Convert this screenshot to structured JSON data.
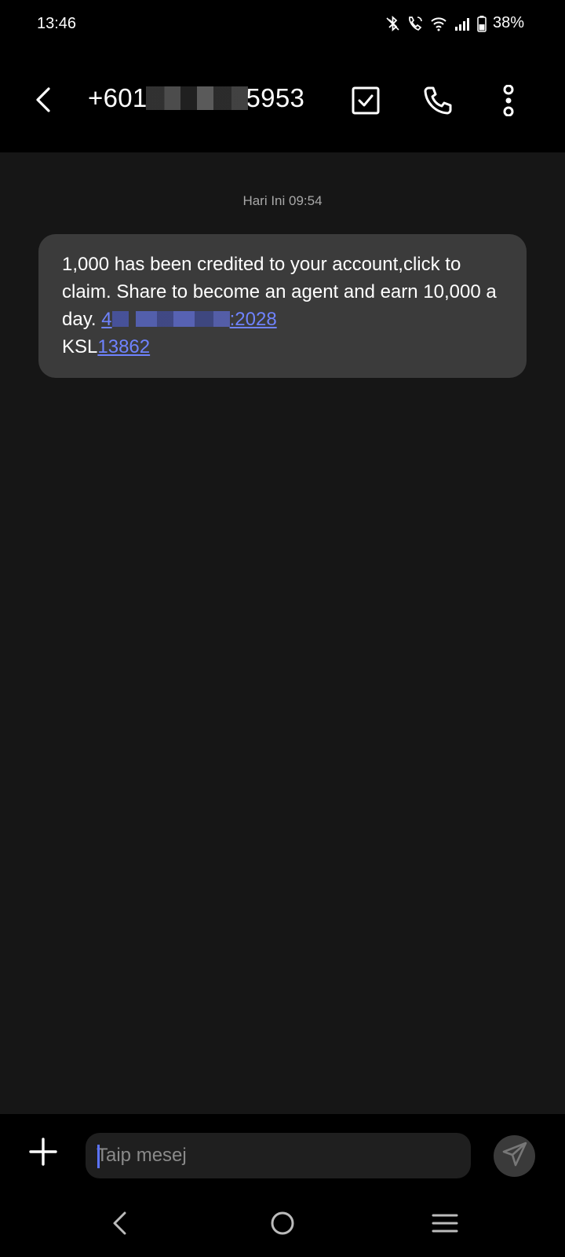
{
  "status_bar": {
    "time": "13:46",
    "battery": "38%",
    "icons": [
      "bluetooth-icon",
      "wifi-calling-icon",
      "wifi-icon",
      "signal-icon",
      "battery-icon"
    ]
  },
  "header": {
    "number_prefix": "+601",
    "number_suffix": "5953",
    "icons": [
      "back-arrow-icon",
      "select-checkbox-icon",
      "phone-call-icon",
      "more-options-icon"
    ]
  },
  "conversation": {
    "date_label": "Hari Ini 09:54",
    "message": {
      "text_main": "1,000 has been credited to your account,click to claim. Share to become an agent and earn 10,000 a day. ",
      "link1_start": "4",
      "link1_end": ":2028",
      "line2_prefix": "KSL",
      "link2": "13862"
    }
  },
  "composer": {
    "placeholder": "Taip mesej",
    "icons": [
      "add-attachment-icon",
      "send-icon"
    ]
  },
  "nav_bar": {
    "icons": [
      "nav-back-icon",
      "nav-home-icon",
      "nav-recents-icon"
    ]
  },
  "colors": {
    "background": "#000000",
    "conversation_bg": "#161616",
    "bubble_bg": "#3b3b3b",
    "link": "#6f83ff",
    "caret": "#5b73ff"
  }
}
